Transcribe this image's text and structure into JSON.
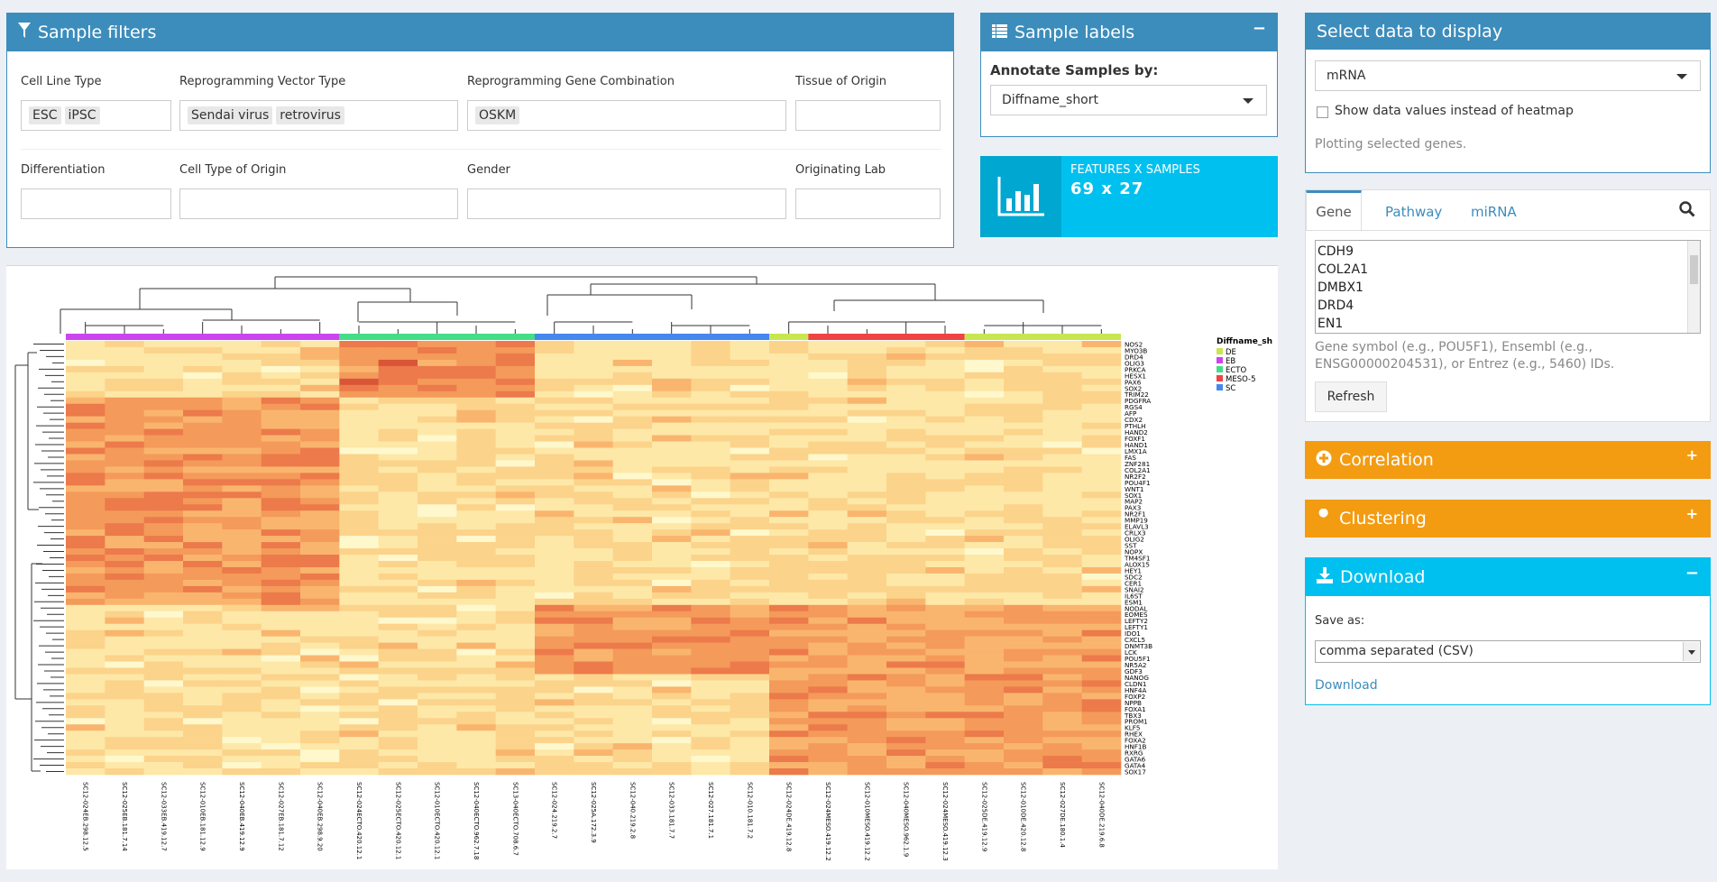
{
  "sample_filters": {
    "title": "Sample filters",
    "fields": [
      {
        "label": "Cell Line Type",
        "tags": [
          "ESC",
          "iPSC"
        ]
      },
      {
        "label": "Reprogramming Vector Type",
        "tags": [
          "Sendai virus",
          "retrovirus"
        ]
      },
      {
        "label": "Reprogramming Gene Combination",
        "tags": [
          "OSKM"
        ]
      },
      {
        "label": "Tissue of Origin",
        "tags": []
      },
      {
        "label": "Differentiation",
        "tags": []
      },
      {
        "label": "Cell Type of Origin",
        "tags": []
      },
      {
        "label": "Gender",
        "tags": []
      },
      {
        "label": "Originating Lab",
        "tags": []
      }
    ]
  },
  "sample_labels": {
    "title": "Sample labels",
    "collapse": "−",
    "annotate_label": "Annotate Samples by:",
    "annotate_value": "Diffname_short"
  },
  "infobox": {
    "title": "FEATURES X SAMPLES",
    "value": "69 x 27",
    "color": "#00c0ef",
    "icon_bg": "#00a7d0"
  },
  "select_data": {
    "title": "Select data to display",
    "dataset": "mRNA",
    "checkbox_label": "Show data values instead of heatmap",
    "status": "Plotting selected genes."
  },
  "gene_tabs": {
    "tabs": [
      "Gene",
      "Pathway",
      "miRNA"
    ],
    "genes": [
      "CDH9",
      "COL2A1",
      "DMBX1",
      "DRD4",
      "EN1"
    ],
    "help": [
      "Gene symbol (e.g., POU5F1), Ensembl (e.g.,",
      "ENSG00000204531), or Entrez (e.g., 5460) IDs."
    ],
    "refresh": "Refresh"
  },
  "correlation": {
    "title": "Correlation",
    "tool": "+"
  },
  "clustering": {
    "title": "Clustering",
    "tool": "+"
  },
  "download": {
    "title": "Download",
    "tool": "−",
    "save_as_label": "Save as:",
    "format": "comma separated (CSV)",
    "link": "Download"
  },
  "heatmap": {
    "legend": {
      "title": "Diffname_sh",
      "items": [
        {
          "label": "DE",
          "color": "#c8e650"
        },
        {
          "label": "EB",
          "color": "#cc44ee"
        },
        {
          "label": "ECTO",
          "color": "#44dd88"
        },
        {
          "label": "MESO-5",
          "color": "#ee4444"
        },
        {
          "label": "SC",
          "color": "#4488ee"
        }
      ]
    },
    "groups": [
      {
        "label": "EB",
        "color": "#cc44ee",
        "count": 7
      },
      {
        "label": "ECTO",
        "color": "#44dd88",
        "count": 5
      },
      {
        "label": "SC",
        "color": "#4488ee",
        "count": 6
      },
      {
        "label": "DE",
        "color": "#c8e650",
        "count": 1
      },
      {
        "label": "MESO-5",
        "color": "#ee4444",
        "count": 4
      },
      {
        "label": "DE",
        "color": "#c8e650",
        "count": 4
      }
    ],
    "genes": [
      "NOS2",
      "MYO3B",
      "DRD4",
      "OLIG3",
      "PRKCA",
      "HESX1",
      "PAX6",
      "SOX2",
      "TRIM22",
      "PDGFRA",
      "RGS4",
      "AFP",
      "CDX2",
      "PTHLH",
      "HAND2",
      "FOXF1",
      "HAND1",
      "LMX1A",
      "FAS",
      "ZNF281",
      "COL2A1",
      "NR2F2",
      "POU4F1",
      "WNT1",
      "SOX1",
      "MAP2",
      "PAX3",
      "NR2F1",
      "MMP19",
      "ELAVL3",
      "CRLX3",
      "OLIG2",
      "SST",
      "NOPX",
      "TM4SF1",
      "ALOX15",
      "HEY1",
      "SDC2",
      "CER1",
      "SNAI2",
      "IL6ST",
      "ESM1",
      "NODAL",
      "EOMES",
      "LEFTY2",
      "LEFTY1",
      "IDO1",
      "CXCL5",
      "DNMT3B",
      "LCK",
      "POU5F1",
      "NR5A2",
      "GDF3",
      "NANOG",
      "CLDN1",
      "HNF4A",
      "FOXP2",
      "NPPB",
      "FOXA1",
      "TBX3",
      "PROM1",
      "KLF5",
      "RHEX",
      "FOXA2",
      "HNF1B",
      "RXRG",
      "GATA6",
      "GATA4",
      "SOX17"
    ],
    "samples": [
      "SC12-024EB.298.12.5",
      "SC12-025EB.181.7.14",
      "SC12-033EB.419.12.7",
      "SC12-010EB.181.12.9",
      "SC12-040EB.419.12.9",
      "SC12-027EB.181.7.12",
      "SC12-040EB.298.9.20",
      "SC12-024ECTO.420.12.1",
      "SC12-025ECTO.420.12.1",
      "SC12-010ECTO.420.12.1",
      "SC12-040ECTO.962.7.18",
      "SC13-040ECTO.708.6.7",
      "SC12-024.219.2.7",
      "SC12-025A.172.3.9",
      "SC12-040.219.2.8",
      "SC12-033.181.7.7",
      "SC12-027.181.7.1",
      "SC12-010.181.7.2",
      "SC12-024DE.419.12.8",
      "SC12-024MESO.419.12.2",
      "SC12-010MESO.419.12.2",
      "SC12-040MESO.962.1.9",
      "SC12-024MESO.419.12.3",
      "SC12-025DE.419.12.9",
      "SC12-010DE.420.12.8",
      "SC12-027DE.180.1.4",
      "SC12-040DE.219.6.8"
    ]
  }
}
